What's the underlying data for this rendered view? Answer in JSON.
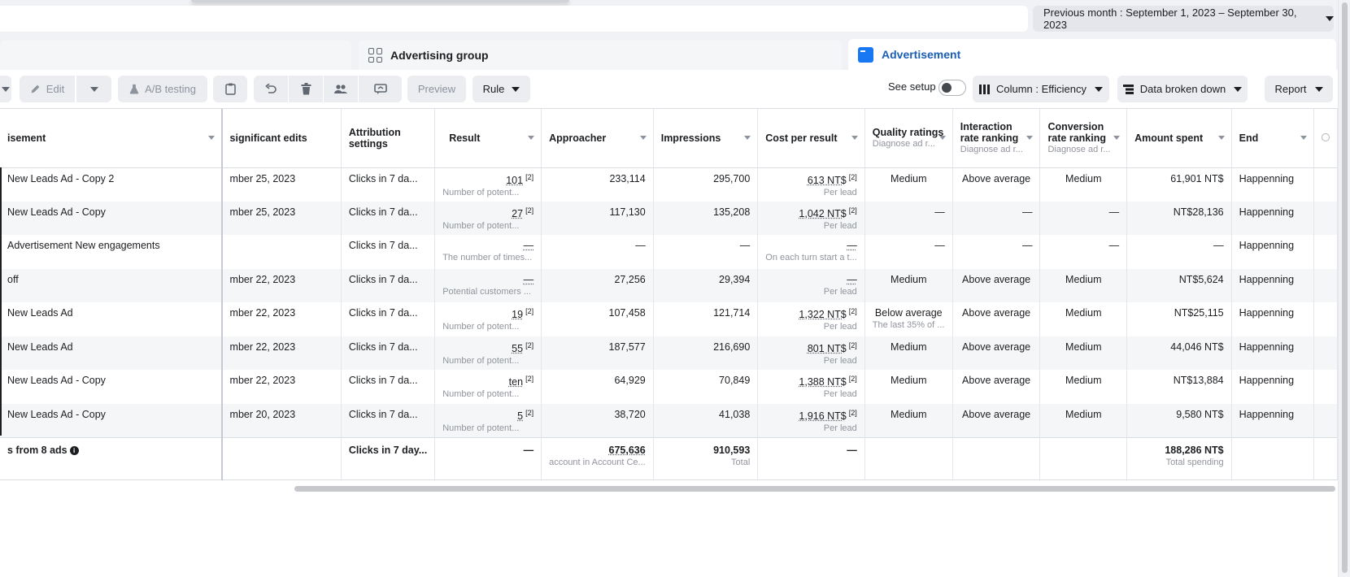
{
  "header": {
    "date_range": "Previous month : September 1, 2023 – September 30, 2023"
  },
  "level_tabs": {
    "group": "Advertising group",
    "ad": "Advertisement"
  },
  "toolbar": {
    "edit": "Edit",
    "ab_testing": "A/B testing",
    "preview": "Preview",
    "rule": "Rule",
    "see_setup": "See setup",
    "column": "Column : Efficiency",
    "breakdown": "Data broken down",
    "report": "Report"
  },
  "columns": {
    "name": "isement",
    "edits": "significant edits",
    "attribution": "Attribution settings",
    "result": "Result",
    "reach": "Approacher",
    "impressions": "Impressions",
    "cpr": "Cost per result",
    "quality": "Quality ratings",
    "quality_sub": "Diagnose ad r...",
    "engagement": "Interaction rate ranking",
    "engagement_sub": "Diagnose ad r...",
    "conversion": "Conversion rate ranking",
    "conversion_sub": "Diagnose ad r...",
    "spent": "Amount spent",
    "end": "End"
  },
  "rows": [
    {
      "name": "New Leads Ad - Copy 2",
      "edits": "mber 25, 2023",
      "attr": "Clicks in 7 da...",
      "result": "101",
      "result_note": "[2]",
      "result_sub": "Number of potent...",
      "reach": "233,114",
      "impr": "295,700",
      "cpr": "613 NT$",
      "cpr_note": "[2]",
      "cpr_sub": "Per lead",
      "quality": "Medium",
      "quality_sub": "",
      "eng": "Above average",
      "conv": "Medium",
      "spent": "61,901 NT$",
      "end": "Happenning"
    },
    {
      "name": "New Leads Ad - Copy",
      "edits": "mber 25, 2023",
      "attr": "Clicks in 7 da...",
      "result": "27",
      "result_note": "[2]",
      "result_sub": "Number of potent...",
      "reach": "117,130",
      "impr": "135,208",
      "cpr": "1,042 NT$",
      "cpr_note": "[2]",
      "cpr_sub": "Per lead",
      "quality": "—",
      "quality_sub": "",
      "eng": "—",
      "conv": "—",
      "spent": "NT$28,136",
      "end": "Happenning"
    },
    {
      "name": "Advertisement New engagements",
      "edits": "",
      "attr": "Clicks in 7 da...",
      "result": "—",
      "result_note": "",
      "result_sub": "The number of times...",
      "reach": "—",
      "impr": "—",
      "cpr": "—",
      "cpr_note": "",
      "cpr_sub": "On each turn start a t...",
      "quality": "—",
      "quality_sub": "",
      "eng": "—",
      "conv": "—",
      "spent": "—",
      "end": "Happenning"
    },
    {
      "name": "off",
      "edits": "mber 22, 2023",
      "attr": "Clicks in 7 da...",
      "result": "—",
      "result_note": "",
      "result_sub": "Potential customers ...",
      "reach": "27,256",
      "impr": "29,394",
      "cpr": "—",
      "cpr_note": "",
      "cpr_sub": "Per lead",
      "quality": "Medium",
      "quality_sub": "",
      "eng": "Above average",
      "conv": "Medium",
      "spent": "NT$5,624",
      "end": "Happenning"
    },
    {
      "name": "New Leads Ad",
      "edits": "mber 22, 2023",
      "attr": "Clicks in 7 da...",
      "result": "19",
      "result_note": "[2]",
      "result_sub": "Number of potent...",
      "reach": "107,458",
      "impr": "121,714",
      "cpr": "1,322 NT$",
      "cpr_note": "[2]",
      "cpr_sub": "Per lead",
      "quality": "Below average",
      "quality_sub": "The last 35% of ...",
      "eng": "Above average",
      "conv": "Medium",
      "spent": "NT$25,115",
      "end": "Happenning"
    },
    {
      "name": "New Leads Ad",
      "edits": "mber 22, 2023",
      "attr": "Clicks in 7 da...",
      "result": "55",
      "result_note": "[2]",
      "result_sub": "Number of potent...",
      "reach": "187,577",
      "impr": "216,690",
      "cpr": "801 NT$",
      "cpr_note": "[2]",
      "cpr_sub": "Per lead",
      "quality": "Medium",
      "quality_sub": "",
      "eng": "Above average",
      "conv": "Medium",
      "spent": "44,046 NT$",
      "end": "Happenning"
    },
    {
      "name": "New Leads Ad - Copy",
      "edits": "mber 22, 2023",
      "attr": "Clicks in 7 da...",
      "result": "ten",
      "result_note": "[2]",
      "result_sub": "Number of potent...",
      "reach": "64,929",
      "impr": "70,849",
      "cpr": "1,388 NT$",
      "cpr_note": "[2]",
      "cpr_sub": "Per lead",
      "quality": "Medium",
      "quality_sub": "",
      "eng": "Above average",
      "conv": "Medium",
      "spent": "NT$13,884",
      "end": "Happenning"
    },
    {
      "name": "New Leads Ad - Copy",
      "edits": "mber 20, 2023",
      "attr": "Clicks in 7 da...",
      "result": "5",
      "result_note": "[2]",
      "result_sub": "Number of potent...",
      "reach": "38,720",
      "impr": "41,038",
      "cpr": "1,916 NT$",
      "cpr_note": "[2]",
      "cpr_sub": "Per lead",
      "quality": "Medium",
      "quality_sub": "",
      "eng": "Above average",
      "conv": "Medium",
      "spent": "9,580 NT$",
      "end": "Happenning"
    }
  ],
  "totals": {
    "label": "s from 8 ads",
    "attr": "Clicks in 7 day...",
    "result": "—",
    "reach": "675,636",
    "reach_sub": "account in Account Ce...",
    "impr": "910,593",
    "impr_sub": "Total",
    "cpr": "—",
    "spent": "188,286 NT$",
    "spent_sub": "Total spending"
  }
}
